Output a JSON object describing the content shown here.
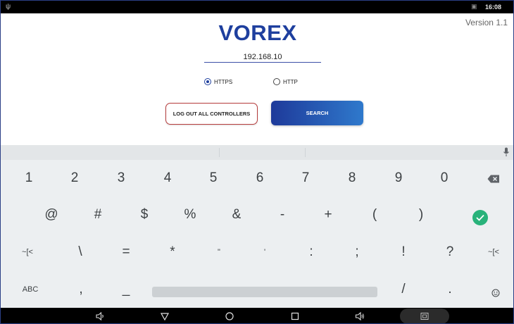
{
  "status_bar": {
    "time": "16:08",
    "icons": [
      "usb-icon",
      "no-sim-icon"
    ]
  },
  "app": {
    "logo": "VOREX",
    "version": "Version 1.1",
    "ip_field": {
      "value": "192.168.10"
    },
    "protocol": {
      "options": [
        {
          "label": "HTTPS",
          "checked": true
        },
        {
          "label": "HTTP",
          "checked": false
        }
      ]
    },
    "buttons": {
      "logout": "LOG OUT ALL CONTROLLERS",
      "search": "SEARCH"
    },
    "colors": {
      "brand": "#1e3f9e",
      "search_start": "#1e3a9a",
      "search_end": "#2f79cc",
      "logout_border": "#b63c3c",
      "enter": "#28b27a"
    }
  },
  "keyboard": {
    "row1": [
      "1",
      "2",
      "3",
      "4",
      "5",
      "6",
      "7",
      "8",
      "9",
      "0"
    ],
    "row2": [
      "@",
      "#",
      "$",
      "%",
      "&",
      "-",
      "+",
      "(",
      ")"
    ],
    "row3": [
      "~[<",
      "\\",
      "=",
      "*",
      "\"",
      "'",
      ":",
      ";",
      "!",
      "?",
      "~[<"
    ],
    "row4": {
      "abc": "ABC",
      "comma": ",",
      "underscore": "_",
      "slash": "/",
      "period": "."
    },
    "icons": [
      "mic-icon",
      "backspace-icon",
      "enter-check-icon",
      "emoji-icon"
    ]
  },
  "nav_bar": {
    "icons": [
      "volume-down-icon",
      "back-icon",
      "home-icon",
      "recents-icon",
      "volume-up-icon",
      "screenshot-icon"
    ]
  }
}
